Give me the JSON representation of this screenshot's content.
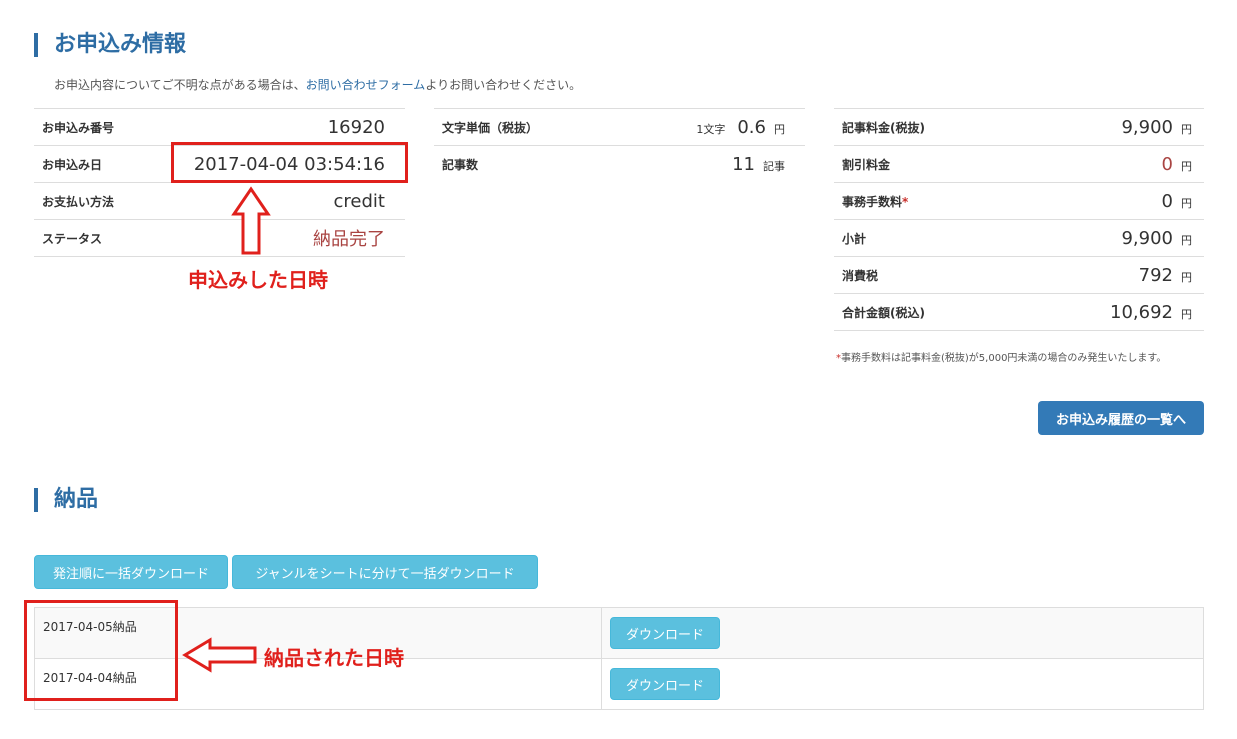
{
  "order_section": {
    "title": "お申込み情報",
    "notice_prefix": "お申込内容についてご不明な点がある場合は、",
    "notice_link": "お問い合わせフォーム",
    "notice_suffix": "よりお問い合わせください。"
  },
  "order_info": [
    {
      "label": "お申込み番号",
      "value": "16920"
    },
    {
      "label": "お申込み日",
      "value": "2017-04-04 03:54:16"
    },
    {
      "label": "お支払い方法",
      "value": "credit"
    },
    {
      "label": "ステータス",
      "value": "納品完了"
    }
  ],
  "unit_info": [
    {
      "label": "文字単価（税抜）",
      "prefix": "1文字",
      "value": "0.6",
      "unit": "円"
    },
    {
      "label": "記事数",
      "value": "11",
      "unit": "記事"
    }
  ],
  "price_info": [
    {
      "label": "記事料金(税抜)",
      "value": "9,900",
      "unit": "円"
    },
    {
      "label": "割引料金",
      "value": "0",
      "unit": "円"
    },
    {
      "label": "事務手数料",
      "asterisk": "*",
      "value": "0",
      "unit": "円"
    },
    {
      "label": "小計",
      "value": "9,900",
      "unit": "円"
    },
    {
      "label": "消費税",
      "value": "792",
      "unit": "円"
    },
    {
      "label": "合計金額(税込)",
      "value": "10,692",
      "unit": "円"
    }
  ],
  "footnote": {
    "star": "*",
    "text": "事務手数料は記事料金(税抜)が5,000円未満の場合のみ発生いたします。"
  },
  "history_button": "お申込み履歴の一覧へ",
  "delivery_section": {
    "title": "納品",
    "bulk_order_button": "発注順に一括ダウンロード",
    "bulk_genre_button": "ジャンルをシートに分けて一括ダウンロード",
    "rows": [
      {
        "date": "2017-04-05納品",
        "button": "ダウンロード"
      },
      {
        "date": "2017-04-04納品",
        "button": "ダウンロード"
      }
    ]
  },
  "annotations": {
    "order_date_note": "申込みした日時",
    "delivery_date_note": "納品された日時",
    "color": "#e0201c"
  },
  "colors": {
    "brand": "#2e6da4",
    "primary_button": "#337ab7",
    "info_button": "#5bc0de",
    "status": "#a94442"
  }
}
